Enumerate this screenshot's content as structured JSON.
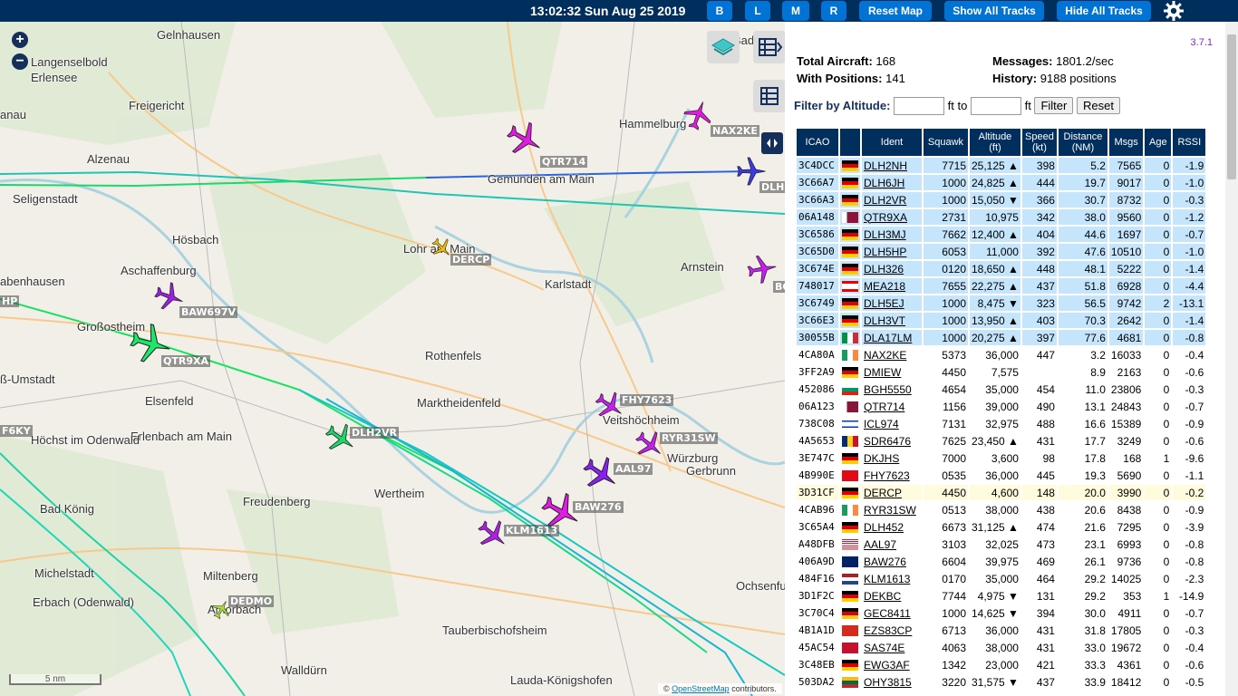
{
  "topbar": {
    "clock": "13:02:32 Sun Aug 25 2019",
    "buttons": [
      "B",
      "L",
      "M",
      "R",
      "Reset Map",
      "Show All Tracks",
      "Hide All Tracks"
    ]
  },
  "map": {
    "towns": [
      "Gelnhausen",
      "Langenselbold",
      "Erlensee",
      "anau",
      "Freigericht",
      "Alzenau",
      "Seligenstadt",
      "Hösbach",
      "Aschaffenburg",
      "abenhausen",
      "Großostheim",
      "ß-Umstadt",
      "Elsenfeld",
      "Erlenbach am Main",
      "Höchst im Odenwald",
      "Bad König",
      "Michelstadt",
      "Erbach (Odenwald)",
      "Amorbach",
      "Miltenberg",
      "Freudenberg",
      "Walldürn",
      "Wertheim",
      "Marktheidenfeld",
      "Rothenfels",
      "Lohr am Main",
      "Gemünden am Main",
      "Karlstadt",
      "Hammelburg",
      "Arnstein",
      "Veitshöchheim",
      "Würzburg",
      "Gerbrunn",
      "Ochsenfu",
      "Tauberbischofsheim",
      "Lauda-Königshofen",
      "Bad"
    ],
    "aircraft_labels": [
      "QTR714",
      "NAX2KE",
      "DLH",
      "DERCP",
      "BO",
      "BAW697V",
      "HP",
      "QTR9XA",
      "DLH2VR",
      "FHY7623",
      "RYR31SW",
      "AAL97",
      "BAW276",
      "KLM1613",
      "F6KY",
      "DEDMO"
    ],
    "scale": "5 nm",
    "attribution_prefix": "©",
    "attribution_link": "OpenStreetMap",
    "attribution_suffix": "contributors.",
    "icons": [
      "zoom-in-icon",
      "zoom-out-icon",
      "layers-icon",
      "table-expand-icon",
      "table-icon",
      "sidebar-toggle-icon",
      "gear-icon"
    ]
  },
  "sidebar": {
    "version": "3.7.1",
    "stats": {
      "total_aircraft_label": "Total Aircraft:",
      "total_aircraft": "168",
      "with_positions_label": "With Positions:",
      "with_positions": "141",
      "messages_label": "Messages:",
      "messages": "1801.2/sec",
      "history_label": "History:",
      "history": "9188 positions"
    },
    "filter": {
      "label": "Filter by Altitude:",
      "to": "ft to",
      "unit": "ft",
      "filter_button": "Filter",
      "reset_button": "Reset"
    },
    "columns": [
      "ICAO",
      "",
      "Ident",
      "Squawk",
      "Altitude (ft)",
      "Speed (kt)",
      "Distance (NM)",
      "Msgs",
      "Age",
      "RSSI"
    ],
    "rows": [
      {
        "icao": "3C4DCC",
        "flag": "de",
        "ident": "DLH2NH",
        "squawk": "7715",
        "alt": "25,125 ▲",
        "speed": "398",
        "dist": "5.2",
        "msgs": "7565",
        "age": "0",
        "rssi": "-1.9",
        "style": "blue"
      },
      {
        "icao": "3C66A7",
        "flag": "de",
        "ident": "DLH6JH",
        "squawk": "1000",
        "alt": "24,825 ▲",
        "speed": "444",
        "dist": "19.7",
        "msgs": "9017",
        "age": "0",
        "rssi": "-1.0",
        "style": "blue"
      },
      {
        "icao": "3C66A3",
        "flag": "de",
        "ident": "DLH2VR",
        "squawk": "1000",
        "alt": "15,050 ▼",
        "speed": "366",
        "dist": "30.7",
        "msgs": "8732",
        "age": "0",
        "rssi": "-0.3",
        "style": "blue"
      },
      {
        "icao": "06A148",
        "flag": "qa",
        "ident": "QTR9XA",
        "squawk": "2731",
        "alt": "10,975",
        "speed": "342",
        "dist": "38.0",
        "msgs": "9560",
        "age": "0",
        "rssi": "-1.2",
        "style": "blue"
      },
      {
        "icao": "3C6586",
        "flag": "de",
        "ident": "DLH3MJ",
        "squawk": "7662",
        "alt": "12,400 ▲",
        "speed": "404",
        "dist": "44.6",
        "msgs": "1697",
        "age": "0",
        "rssi": "-0.7",
        "style": "blue"
      },
      {
        "icao": "3C65D0",
        "flag": "de",
        "ident": "DLH5HP",
        "squawk": "6053",
        "alt": "11,000",
        "speed": "392",
        "dist": "47.6",
        "msgs": "10510",
        "age": "0",
        "rssi": "-1.0",
        "style": "blue"
      },
      {
        "icao": "3C674E",
        "flag": "de",
        "ident": "DLH326",
        "squawk": "0120",
        "alt": "18,650 ▲",
        "speed": "448",
        "dist": "48.1",
        "msgs": "5222",
        "age": "0",
        "rssi": "-1.4",
        "style": "blue"
      },
      {
        "icao": "748017",
        "flag": "lb",
        "ident": "MEA218",
        "squawk": "7655",
        "alt": "22,275 ▲",
        "speed": "437",
        "dist": "51.8",
        "msgs": "6928",
        "age": "0",
        "rssi": "-4.4",
        "style": "blue"
      },
      {
        "icao": "3C6749",
        "flag": "de",
        "ident": "DLH5EJ",
        "squawk": "1000",
        "alt": "8,475 ▼",
        "speed": "323",
        "dist": "56.5",
        "msgs": "9742",
        "age": "2",
        "rssi": "-13.1",
        "style": "blue"
      },
      {
        "icao": "3C66E3",
        "flag": "de",
        "ident": "DLH3VT",
        "squawk": "1000",
        "alt": "13,950 ▲",
        "speed": "403",
        "dist": "70.3",
        "msgs": "2642",
        "age": "0",
        "rssi": "-1.4",
        "style": "blue"
      },
      {
        "icao": "30055B",
        "flag": "it",
        "ident": "DLA17LM",
        "squawk": "1000",
        "alt": "20,275 ▲",
        "speed": "397",
        "dist": "77.6",
        "msgs": "4681",
        "age": "0",
        "rssi": "-0.8",
        "style": "blue"
      },
      {
        "icao": "4CA80A",
        "flag": "ie",
        "ident": "NAX2KE",
        "squawk": "5373",
        "alt": "36,000",
        "speed": "447",
        "dist": "3.2",
        "msgs": "16033",
        "age": "0",
        "rssi": "-0.4",
        "style": "white"
      },
      {
        "icao": "3FF2A9",
        "flag": "de",
        "ident": "DMIEW",
        "squawk": "4450",
        "alt": "7,575",
        "speed": "",
        "dist": "8.9",
        "msgs": "2163",
        "age": "0",
        "rssi": "-0.6",
        "style": "white"
      },
      {
        "icao": "452086",
        "flag": "bg",
        "ident": "BGH5550",
        "squawk": "4654",
        "alt": "35,000",
        "speed": "454",
        "dist": "11.0",
        "msgs": "23806",
        "age": "0",
        "rssi": "-0.3",
        "style": "white"
      },
      {
        "icao": "06A123",
        "flag": "qa",
        "ident": "QTR714",
        "squawk": "1156",
        "alt": "39,000",
        "speed": "490",
        "dist": "13.1",
        "msgs": "24843",
        "age": "0",
        "rssi": "-0.7",
        "style": "white"
      },
      {
        "icao": "738C08",
        "flag": "il",
        "ident": "ICL974",
        "squawk": "7131",
        "alt": "32,975",
        "speed": "488",
        "dist": "16.6",
        "msgs": "15389",
        "age": "0",
        "rssi": "-0.9",
        "style": "white"
      },
      {
        "icao": "4A5653",
        "flag": "ro",
        "ident": "SDR6476",
        "squawk": "7625",
        "alt": "23,450 ▲",
        "speed": "431",
        "dist": "17.7",
        "msgs": "3249",
        "age": "0",
        "rssi": "-0.6",
        "style": "white"
      },
      {
        "icao": "3E747C",
        "flag": "de",
        "ident": "DKJHS",
        "squawk": "7000",
        "alt": "3,600",
        "speed": "98",
        "dist": "17.8",
        "msgs": "168",
        "age": "1",
        "rssi": "-9.6",
        "style": "white"
      },
      {
        "icao": "4B990E",
        "flag": "tr",
        "ident": "FHY7623",
        "squawk": "0535",
        "alt": "36,000",
        "speed": "445",
        "dist": "19.3",
        "msgs": "5690",
        "age": "0",
        "rssi": "-1.1",
        "style": "white"
      },
      {
        "icao": "3D31CF",
        "flag": "de",
        "ident": "DERCP",
        "squawk": "4450",
        "alt": "4,600",
        "speed": "148",
        "dist": "20.0",
        "msgs": "3990",
        "age": "0",
        "rssi": "-0.2",
        "style": "sel"
      },
      {
        "icao": "4CAB96",
        "flag": "ie",
        "ident": "RYR31SW",
        "squawk": "0513",
        "alt": "38,000",
        "speed": "438",
        "dist": "20.6",
        "msgs": "8438",
        "age": "0",
        "rssi": "-0.9",
        "style": "white"
      },
      {
        "icao": "3C65A4",
        "flag": "de",
        "ident": "DLH452",
        "squawk": "6673",
        "alt": "31,125 ▲",
        "speed": "474",
        "dist": "21.6",
        "msgs": "7295",
        "age": "0",
        "rssi": "-3.9",
        "style": "white"
      },
      {
        "icao": "A48DFB",
        "flag": "us",
        "ident": "AAL97",
        "squawk": "3103",
        "alt": "32,025",
        "speed": "473",
        "dist": "23.1",
        "msgs": "6993",
        "age": "0",
        "rssi": "-0.8",
        "style": "white"
      },
      {
        "icao": "406A9D",
        "flag": "gb",
        "ident": "BAW276",
        "squawk": "6604",
        "alt": "39,975",
        "speed": "469",
        "dist": "26.1",
        "msgs": "9736",
        "age": "0",
        "rssi": "-0.8",
        "style": "white"
      },
      {
        "icao": "484F16",
        "flag": "nl",
        "ident": "KLM1613",
        "squawk": "0170",
        "alt": "35,000",
        "speed": "464",
        "dist": "29.2",
        "msgs": "14025",
        "age": "0",
        "rssi": "-2.3",
        "style": "white"
      },
      {
        "icao": "3D1F2C",
        "flag": "de",
        "ident": "DEKBC",
        "squawk": "7744",
        "alt": "4,975 ▼",
        "speed": "131",
        "dist": "29.2",
        "msgs": "353",
        "age": "1",
        "rssi": "-14.9",
        "style": "white"
      },
      {
        "icao": "3C70C4",
        "flag": "de",
        "ident": "GEC8411",
        "squawk": "1000",
        "alt": "14,625 ▼",
        "speed": "394",
        "dist": "30.0",
        "msgs": "4911",
        "age": "0",
        "rssi": "-0.7",
        "style": "white"
      },
      {
        "icao": "4B1A1D",
        "flag": "ch",
        "ident": "EZS83CP",
        "squawk": "6713",
        "alt": "36,000",
        "speed": "431",
        "dist": "31.8",
        "msgs": "17805",
        "age": "0",
        "rssi": "-0.3",
        "style": "white"
      },
      {
        "icao": "45AC54",
        "flag": "dk",
        "ident": "SAS74E",
        "squawk": "4063",
        "alt": "38,000",
        "speed": "431",
        "dist": "33.0",
        "msgs": "19672",
        "age": "0",
        "rssi": "-0.4",
        "style": "white"
      },
      {
        "icao": "3C48EB",
        "flag": "de",
        "ident": "EWG3AF",
        "squawk": "1342",
        "alt": "23,000",
        "speed": "421",
        "dist": "33.3",
        "msgs": "4361",
        "age": "0",
        "rssi": "-0.6",
        "style": "white"
      },
      {
        "icao": "503DA2",
        "flag": "lt",
        "ident": "OHY3815",
        "squawk": "3220",
        "alt": "31,575 ▼",
        "speed": "437",
        "dist": "33.9",
        "msgs": "18412",
        "age": "0",
        "rssi": "-0.5",
        "style": "white"
      }
    ]
  }
}
